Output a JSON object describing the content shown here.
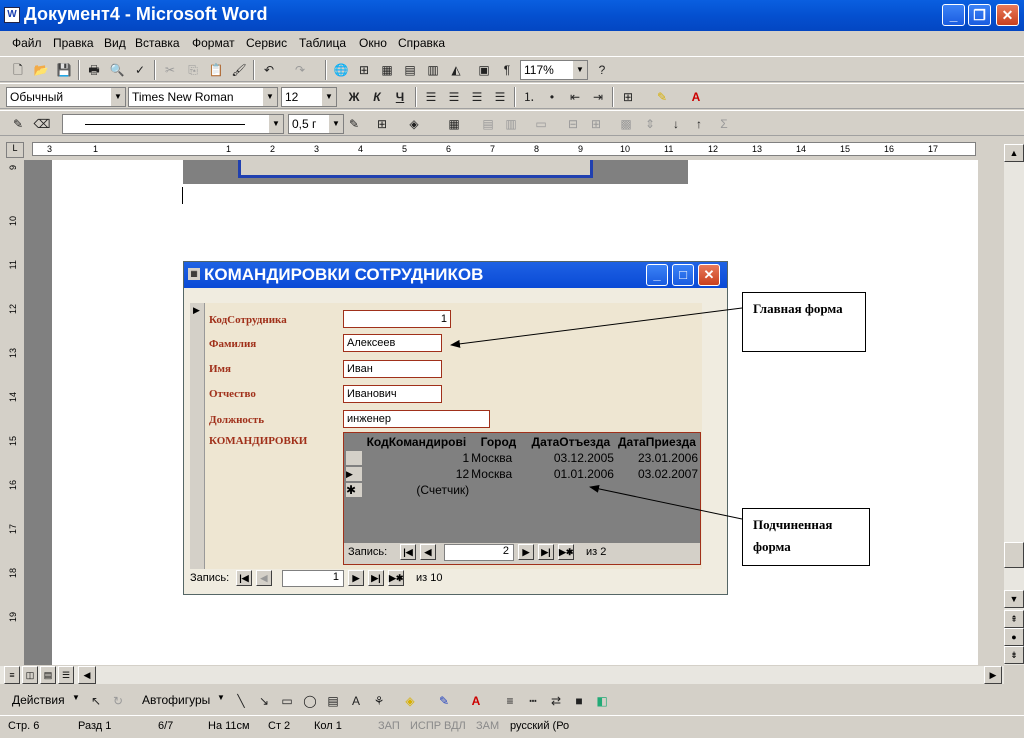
{
  "window": {
    "title": "Документ4 - Microsoft Word",
    "icon": "W"
  },
  "menu": [
    "Файл",
    "Правка",
    "Вид",
    "Вставка",
    "Формат",
    "Сервис",
    "Таблица",
    "Окно",
    "Справка"
  ],
  "toolbar": {
    "zoom": "117%",
    "style": "Обычный",
    "font": "Times New Roman",
    "size": "12",
    "line_weight": "0,5 г"
  },
  "ruler": {
    "h_labels": [
      "3",
      "1",
      "1",
      "2",
      "3",
      "4",
      "5",
      "6",
      "7",
      "8",
      "9",
      "10",
      "11",
      "12",
      "13",
      "14",
      "15",
      "16",
      "17"
    ],
    "v_labels": [
      "9",
      "10",
      "11",
      "12",
      "13",
      "14",
      "15",
      "16",
      "17",
      "18",
      "19"
    ]
  },
  "access": {
    "title": "КОМАНДИРОВКИ СОТРУДНИКОВ",
    "fields": [
      {
        "label": "КодСотрудника",
        "value": "1"
      },
      {
        "label": "Фамилия",
        "value": "Алексеев"
      },
      {
        "label": "Имя",
        "value": "Иван"
      },
      {
        "label": "Отчество",
        "value": "Иванович"
      },
      {
        "label": "Должность",
        "value": "инженер"
      }
    ],
    "sub_label": "КОМАНДИРОВКИ",
    "sub_headers": [
      "КодКомандирові",
      "Город",
      "ДатаОтъезда",
      "ДатаПриезда"
    ],
    "sub_rows": [
      [
        "1",
        "Москва",
        "03.12.2005",
        "23.01.2006"
      ],
      [
        "12",
        "Москва",
        "01.01.2006",
        "03.02.2007"
      ],
      [
        "(Счетчик)",
        "",
        "",
        ""
      ]
    ],
    "sub_nav": {
      "label": "Запись:",
      "current": "2",
      "of": "из  2"
    },
    "main_nav": {
      "label": "Запись:",
      "current": "1",
      "of": "из  10"
    }
  },
  "callouts": {
    "main": "Главная форма",
    "sub": "Подчиненная форма"
  },
  "drawbar": {
    "actions": "Действия",
    "autoshapes": "Автофигуры"
  },
  "status": {
    "page": "Стр.  6",
    "section": "Разд  1",
    "pages": "6/7",
    "at": "На  11см",
    "line": "Ст  2",
    "col": "Кол  1",
    "rec": "ЗАП",
    "trk": "ИСПР",
    "ext": "ВДЛ",
    "ovr": "ЗАМ",
    "lang": "русский (Ро"
  }
}
